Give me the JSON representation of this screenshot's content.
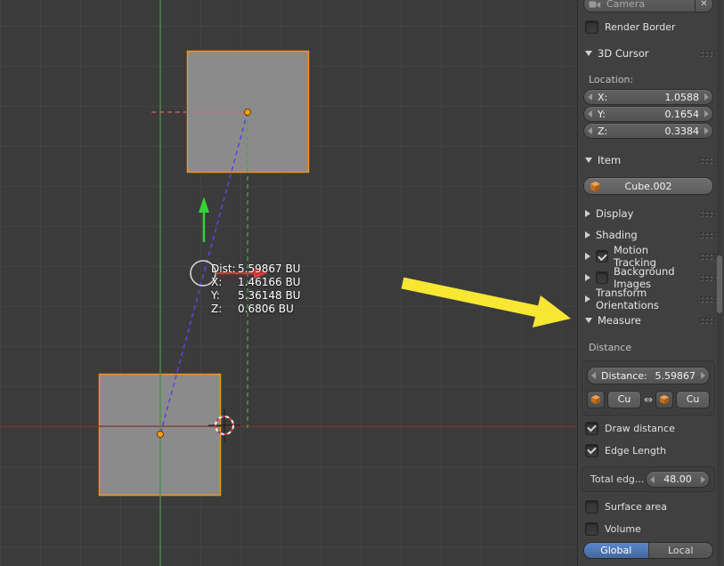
{
  "icons": {
    "close": "✕",
    "swap": "⇔"
  },
  "colors": {
    "accent_blue": "#4f7cc2",
    "selection_orange": "#f6911e",
    "annotation_yellow": "#f7e733",
    "measure_line_purple": "#5547e0",
    "axis_red": "#7b3535",
    "axis_green": "#4c8c4c"
  },
  "viewport": {
    "readout": {
      "rows": [
        {
          "label": "Dist:",
          "value": "5.59867 BU"
        },
        {
          "label": "X:",
          "value": "1.46166 BU"
        },
        {
          "label": "Y:",
          "value": "5.36148 BU"
        },
        {
          "label": "Z:",
          "value": "0.6806 BU"
        }
      ]
    }
  },
  "sidebar": {
    "camera_field": {
      "label": "Camera"
    },
    "render_border": {
      "label": "Render Border",
      "checked": false
    },
    "cursor3d": {
      "title": "3D Cursor",
      "location_label": "Location:",
      "x": {
        "label": "X:",
        "value": "1.0588"
      },
      "y": {
        "label": "Y:",
        "value": "0.1654"
      },
      "z": {
        "label": "Z:",
        "value": "0.3384"
      }
    },
    "item": {
      "title": "Item",
      "object_name": "Cube.002"
    },
    "display": {
      "title": "Display"
    },
    "shading": {
      "title": "Shading"
    },
    "motion_tracking": {
      "title": "Motion Tracking",
      "checked": true
    },
    "background_images": {
      "title": "Background Images",
      "checked": false
    },
    "transform_orientations": {
      "title": "Transform Orientations"
    },
    "measure": {
      "title": "Measure",
      "distance_section_label": "Distance",
      "distance_field": {
        "label": "Distance:",
        "value": "5.59867"
      },
      "target_a": "Cu",
      "target_b": "Cu",
      "draw_distance_label": "Draw distance",
      "draw_distance_checked": true,
      "edge_length_label": "Edge Length",
      "edge_length_checked": true,
      "total_edge": {
        "label": "Total edg...",
        "value": "48.00"
      },
      "surface_area_label": "Surface area",
      "surface_area_checked": false,
      "volume_label": "Volume",
      "volume_checked": false,
      "global_label": "Global",
      "local_label": "Local"
    }
  }
}
